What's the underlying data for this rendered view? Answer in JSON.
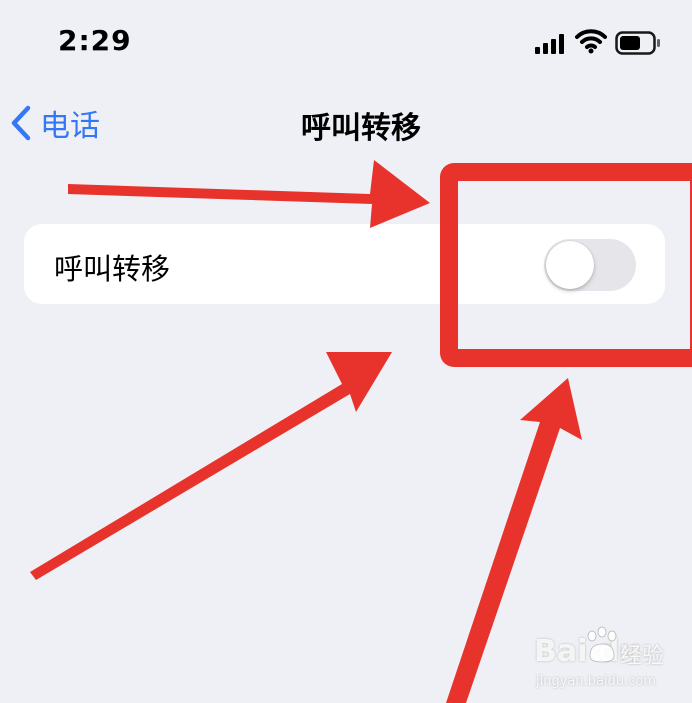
{
  "status_bar": {
    "time": "2:29",
    "icons": [
      "cellular-signal-icon",
      "wifi-icon",
      "battery-icon"
    ]
  },
  "nav": {
    "back_label": "电话",
    "title": "呼叫转移"
  },
  "settings": {
    "row_label": "呼叫转移",
    "toggle_on": false
  },
  "annotation": {
    "color": "#e8332c"
  },
  "watermark": {
    "brand": "Bai du",
    "cn": "经验",
    "url": "jingyan.baidu.com"
  },
  "colors": {
    "background": "#eff0f5",
    "accent": "#3478f6",
    "toggle_off": "#e5e5ea"
  }
}
